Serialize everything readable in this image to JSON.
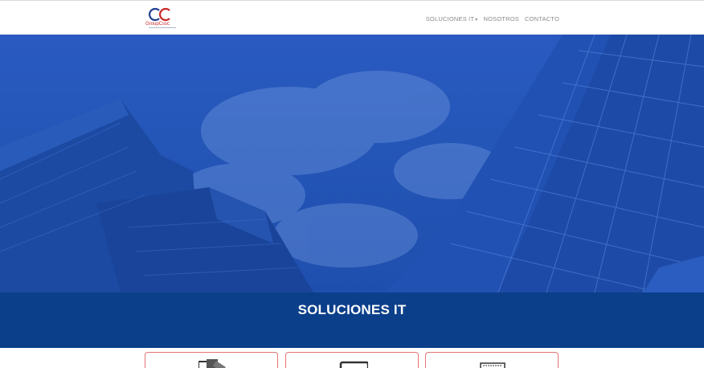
{
  "brand": {
    "name": "GroupCssc",
    "colors": {
      "red": "#c62828",
      "blue": "#1f3f8f"
    }
  },
  "nav": {
    "items": [
      {
        "label": "SOLUCIONES IT",
        "dropdown": true,
        "icon": "caret-down-icon"
      },
      {
        "label": "NOSOTROS"
      },
      {
        "label": "CONTACTO"
      }
    ]
  },
  "hero": {
    "title": "SOLUCIONES IT",
    "background": "blue-tinted-skyscrapers-photo",
    "colors": {
      "overlay": "#2456b8",
      "band": "#0b3f8a"
    }
  },
  "cards": [
    {
      "icon": "devices-icon"
    },
    {
      "icon": "monitor-icon"
    },
    {
      "icon": "keyboard-icon"
    }
  ]
}
